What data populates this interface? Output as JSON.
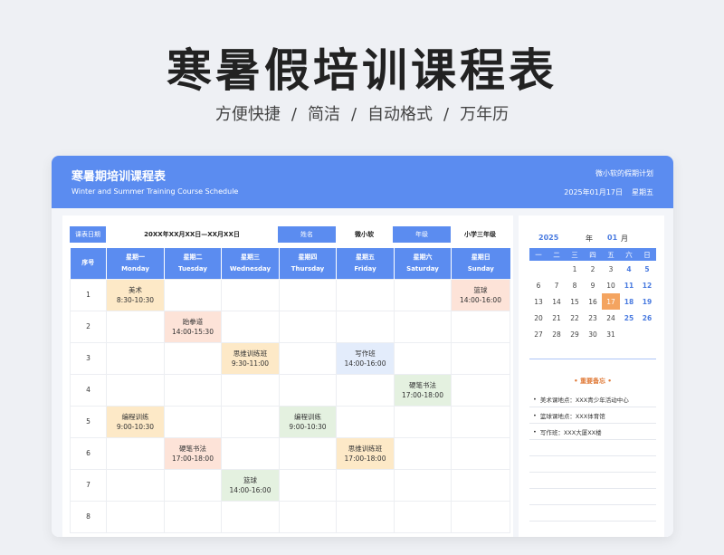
{
  "hero": {
    "title": "寒暑假培训课程表",
    "tags": [
      "方便快捷",
      "/",
      "简洁",
      "/",
      "自动格式",
      "/",
      "万年历"
    ]
  },
  "card": {
    "title": "寒暑期培训课程表",
    "subtitle_en": "Winter and Summer Training Course Schedule",
    "owner_note": "微小软的假期计划",
    "date": "2025年01月17日",
    "weekday": "星期五"
  },
  "info": {
    "date_label": "课表日期",
    "date_value": "20XX年XX月XX日—XX月XX日",
    "name_label": "姓名",
    "name_value": "微小软",
    "grade_label": "年级",
    "grade_value": "小学三年级"
  },
  "table": {
    "index_header": "序号",
    "days": [
      {
        "cn": "星期一",
        "en": "Monday"
      },
      {
        "cn": "星期二",
        "en": "Tuesday"
      },
      {
        "cn": "星期三",
        "en": "Wednesday"
      },
      {
        "cn": "星期四",
        "en": "Thursday"
      },
      {
        "cn": "星期五",
        "en": "Friday"
      },
      {
        "cn": "星期六",
        "en": "Saturday"
      },
      {
        "cn": "星期日",
        "en": "Sunday"
      }
    ],
    "rows": [
      {
        "num": "1",
        "cells": [
          {
            "name": "美术",
            "time": "8:30-10:30",
            "color": "orange"
          },
          null,
          null,
          null,
          null,
          null,
          {
            "name": "篮球",
            "time": "14:00-16:00",
            "color": "pink"
          }
        ]
      },
      {
        "num": "2",
        "cells": [
          null,
          {
            "name": "跆拳道",
            "time": "14:00-15:30",
            "color": "pink"
          },
          null,
          null,
          null,
          null,
          null
        ]
      },
      {
        "num": "3",
        "cells": [
          null,
          null,
          {
            "name": "思维训练班",
            "time": "9:30-11:00",
            "color": "orange"
          },
          null,
          {
            "name": "写作班",
            "time": "14:00-16:00",
            "color": "blue"
          },
          null,
          null
        ]
      },
      {
        "num": "4",
        "cells": [
          null,
          null,
          null,
          null,
          null,
          {
            "name": "硬笔书法",
            "time": "17:00-18:00",
            "color": "green"
          },
          null
        ]
      },
      {
        "num": "5",
        "cells": [
          {
            "name": "编程训练",
            "time": "9:00-10:30",
            "color": "orange"
          },
          null,
          null,
          {
            "name": "编程训练",
            "time": "9:00-10:30",
            "color": "green"
          },
          null,
          null,
          null
        ]
      },
      {
        "num": "6",
        "cells": [
          null,
          {
            "name": "硬笔书法",
            "time": "17:00-18:00",
            "color": "pink"
          },
          null,
          null,
          {
            "name": "思维训练班",
            "time": "17:00-18:00",
            "color": "orange"
          },
          null,
          null
        ]
      },
      {
        "num": "7",
        "cells": [
          null,
          null,
          {
            "name": "篮球",
            "time": "14:00-16:00",
            "color": "green"
          },
          null,
          null,
          null,
          null
        ]
      },
      {
        "num": "8",
        "cells": [
          null,
          null,
          null,
          null,
          null,
          null,
          null
        ]
      }
    ]
  },
  "calendar": {
    "year": "2025",
    "year_unit": "年",
    "month": "01",
    "month_unit": "月",
    "weekdays": [
      "一",
      "二",
      "三",
      "四",
      "五",
      "六",
      "日"
    ],
    "days": [
      "",
      "",
      "1",
      "2",
      "3",
      "4",
      "5",
      "6",
      "7",
      "8",
      "9",
      "10",
      "11",
      "12",
      "13",
      "14",
      "15",
      "16",
      "17",
      "18",
      "19",
      "20",
      "21",
      "22",
      "23",
      "24",
      "25",
      "26",
      "27",
      "28",
      "29",
      "30",
      "31",
      "",
      ""
    ],
    "today": "17"
  },
  "memo": {
    "title": "• 重要备忘 •",
    "items": [
      "美术课地点：XXX青少年活动中心",
      "篮球课地点：XXX体育馆",
      "写作班：XXX大厦XX楼",
      "",
      "",
      "",
      "",
      "",
      ""
    ]
  }
}
